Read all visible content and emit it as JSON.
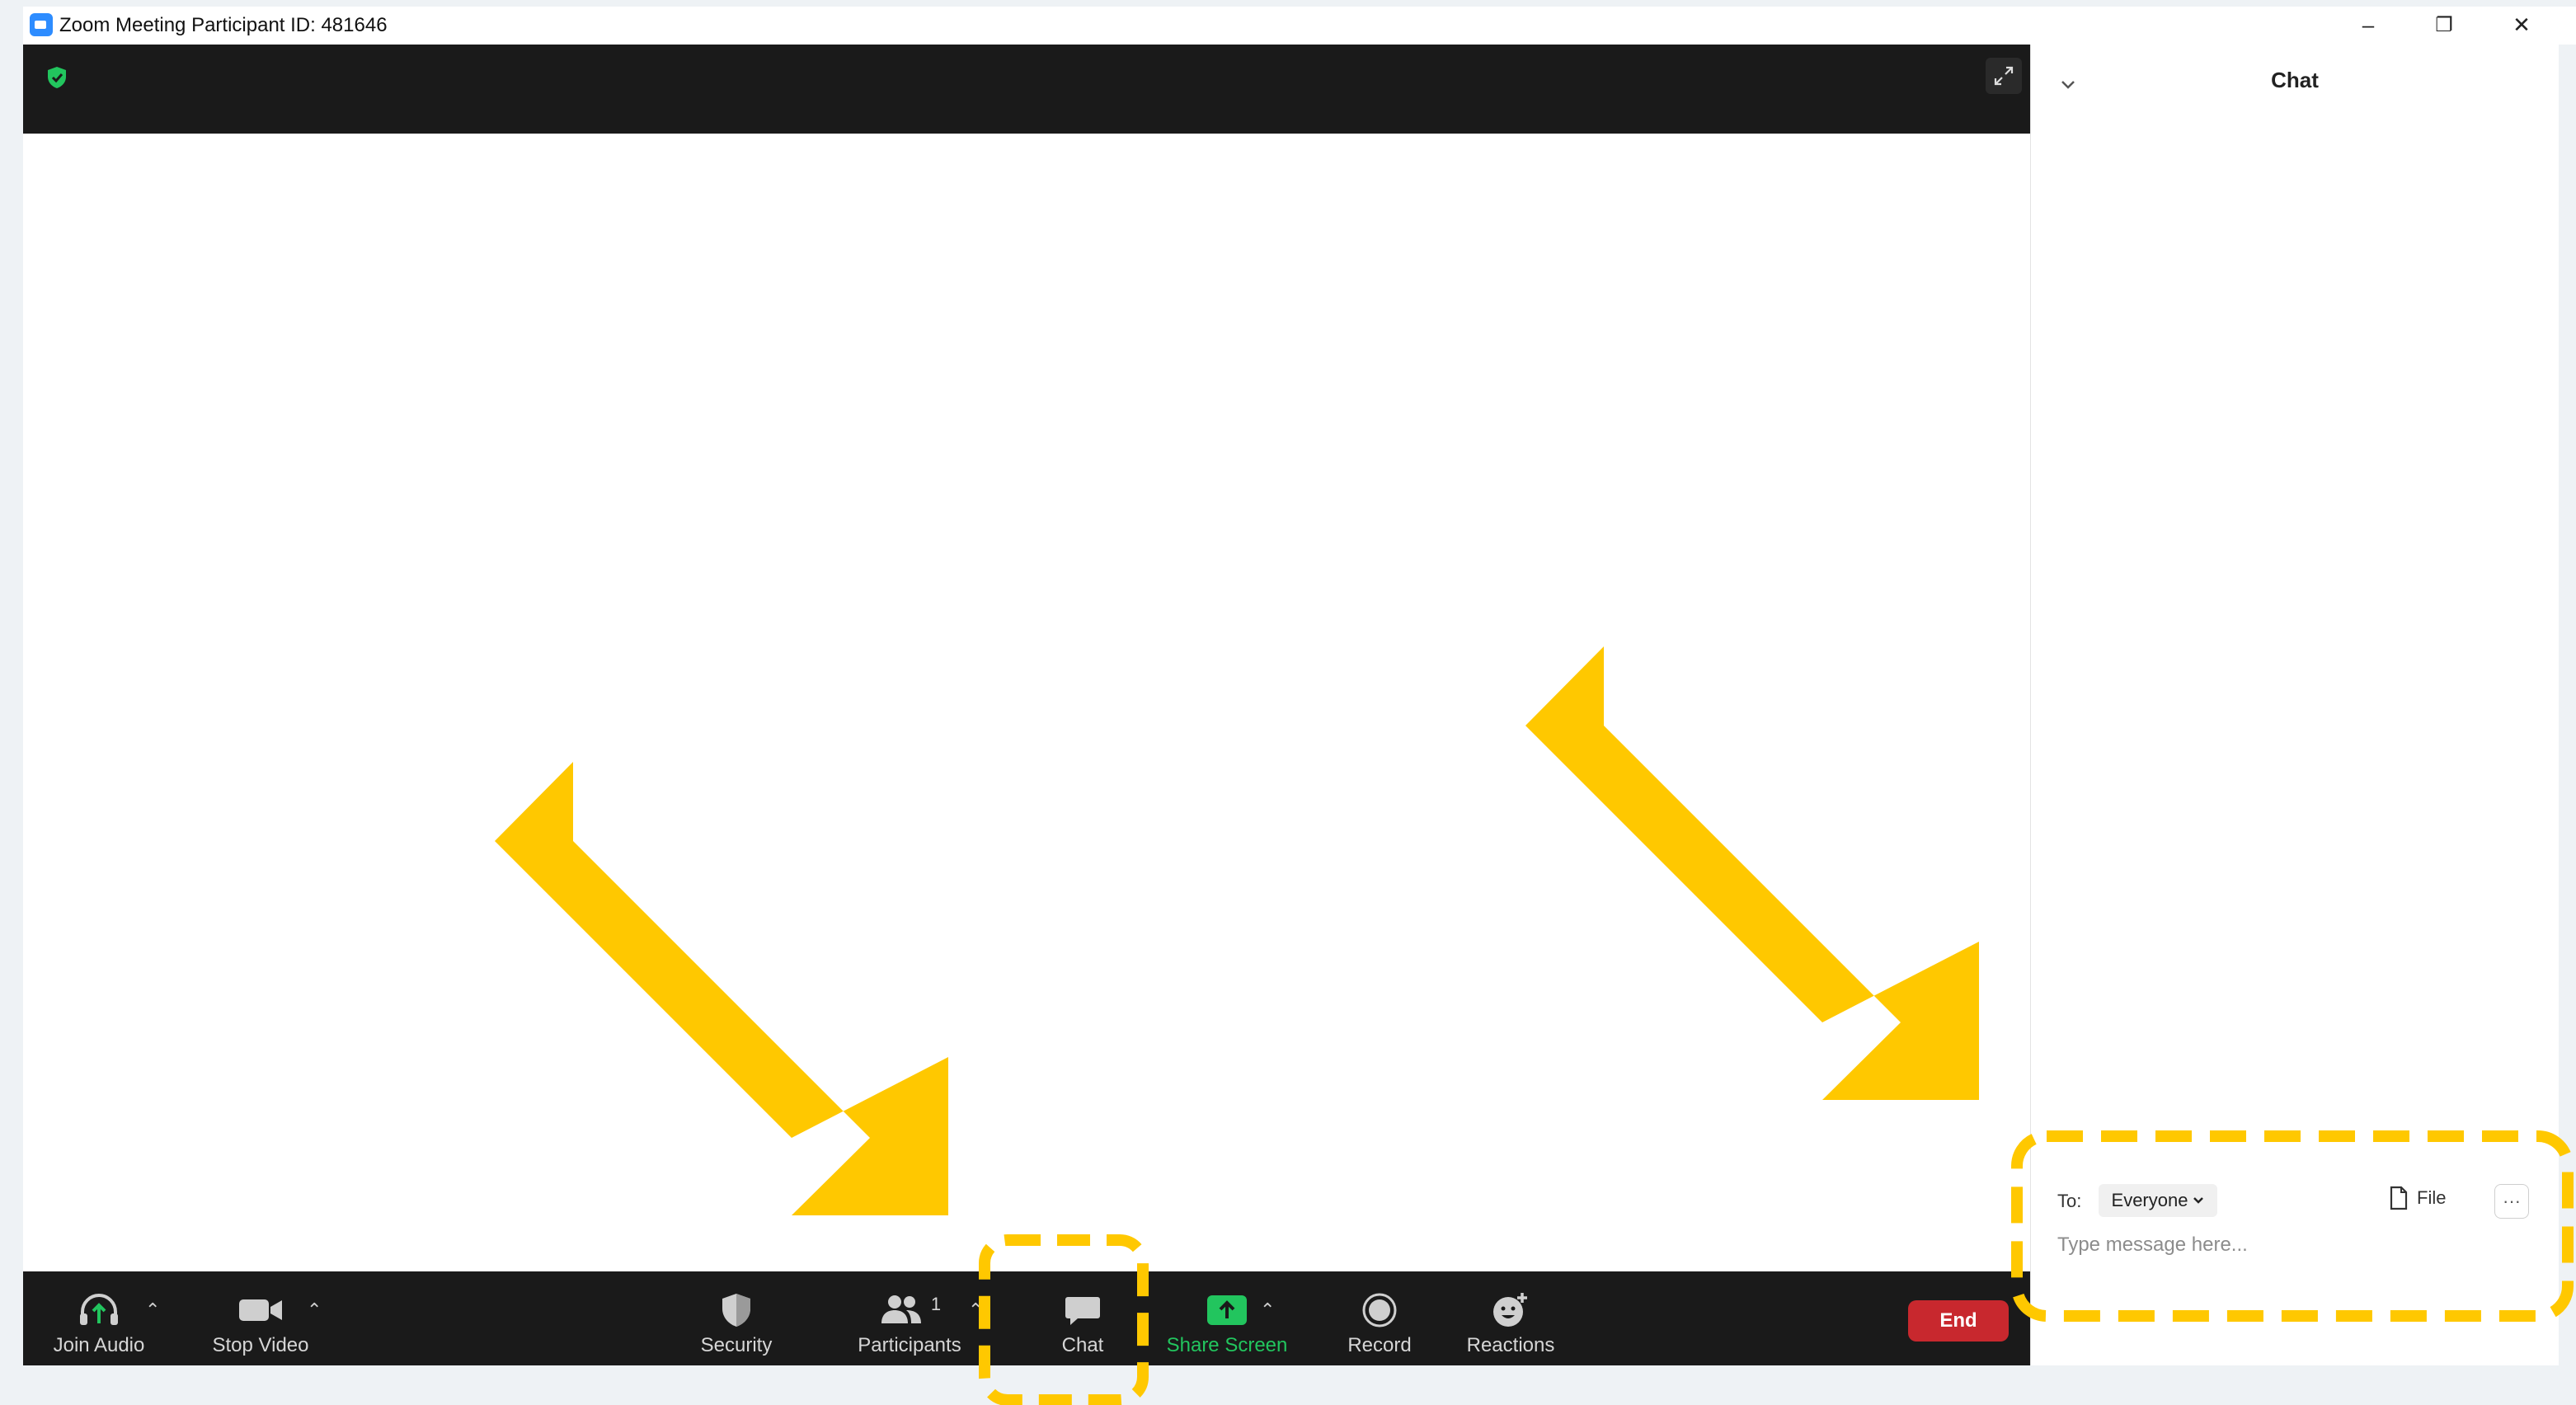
{
  "window": {
    "title": "Zoom Meeting Participant ID: 481646",
    "minimize_glyph": "–",
    "restore_glyph": "❐",
    "close_glyph": "✕"
  },
  "toolbar": {
    "join_audio": "Join Audio",
    "stop_video": "Stop Video",
    "security": "Security",
    "participants": "Participants",
    "participants_count": "1",
    "chat": "Chat",
    "share_screen": "Share Screen",
    "record": "Record",
    "reactions": "Reactions",
    "end": "End"
  },
  "chat_panel": {
    "title": "Chat",
    "to_label": "To:",
    "recipient": "Everyone",
    "file_label": "File",
    "more_glyph": "···",
    "input_placeholder": "Type message here..."
  },
  "colors": {
    "accent_green": "#22c55e",
    "highlight_yellow": "#ffc800",
    "end_red": "#c8282e",
    "zoom_blue": "#2d8cff"
  },
  "icons": [
    "zoom-app-icon",
    "encryption-shield-icon",
    "fullscreen-icon",
    "headphone-icon",
    "video-camera-icon",
    "security-shield-icon",
    "participants-icon",
    "chat-bubble-icon",
    "share-screen-icon",
    "record-icon",
    "reactions-icon",
    "file-icon",
    "chevron-down-icon"
  ]
}
